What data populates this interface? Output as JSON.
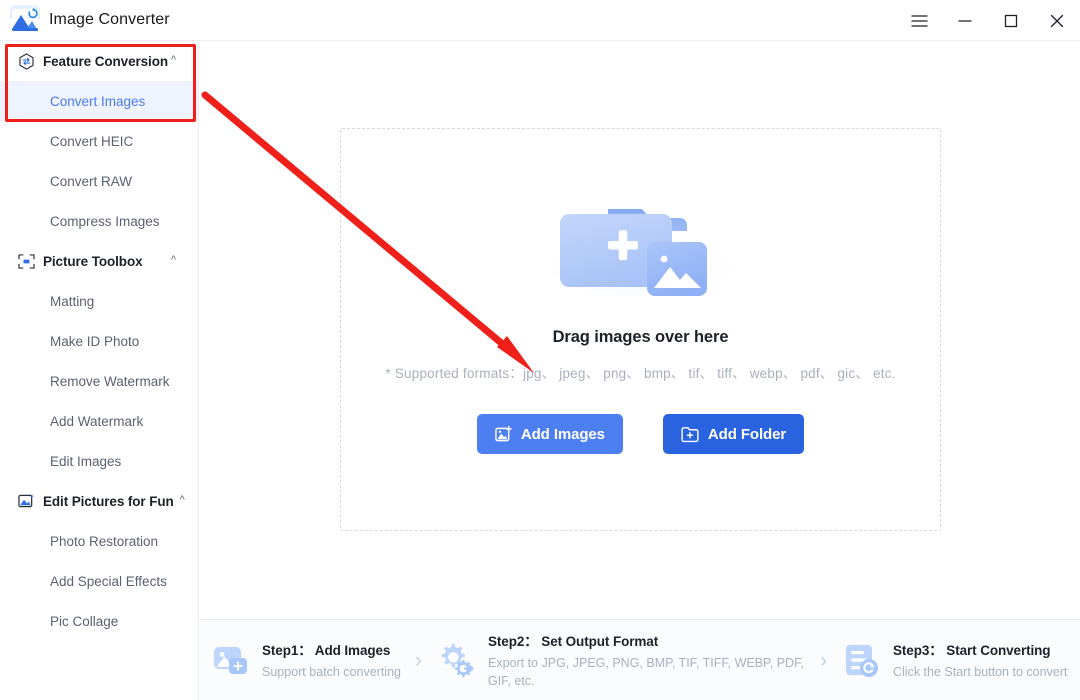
{
  "window": {
    "app_title": "Image Converter",
    "logo_icon": "image-sync-logo",
    "controls": [
      {
        "name": "menu-button",
        "icon": "hamburger-icon"
      },
      {
        "name": "minimize-button",
        "icon": "minimize-icon"
      },
      {
        "name": "maximize-button",
        "icon": "maximize-icon"
      },
      {
        "name": "close-button",
        "icon": "close-icon"
      }
    ]
  },
  "sidebar": {
    "groups": [
      {
        "label": "Feature Conversion",
        "icon": "hexagon-convert-icon",
        "chevron": "chevron-up-icon",
        "expanded": true,
        "items": [
          {
            "label": "Convert Images",
            "active": true
          },
          {
            "label": "Convert HEIC",
            "active": false
          },
          {
            "label": "Convert RAW",
            "active": false
          },
          {
            "label": "Compress Images",
            "active": false
          }
        ]
      },
      {
        "label": "Picture Toolbox",
        "icon": "toolbox-icon",
        "chevron": "chevron-up-icon",
        "expanded": true,
        "items": [
          {
            "label": "Matting",
            "active": false
          },
          {
            "label": "Make ID Photo",
            "active": false
          },
          {
            "label": "Remove Watermark",
            "active": false
          },
          {
            "label": "Add Watermark",
            "active": false
          },
          {
            "label": "Edit Images",
            "active": false
          }
        ]
      },
      {
        "label": "Edit Pictures for Fun",
        "icon": "photo-magic-icon",
        "chevron": "chevron-up-icon",
        "expanded": true,
        "items": [
          {
            "label": "Photo Restoration",
            "active": false
          },
          {
            "label": "Add Special Effects",
            "active": false
          },
          {
            "label": "Pic Collage",
            "active": false
          }
        ]
      }
    ]
  },
  "dropzone": {
    "illustration_icon": "folder-add-image-illustration",
    "title": "Drag images over here",
    "formats_note": "* Supported formats：jpg、 jpeg、 png、 bmp、 tif、 tiff、 webp、 pdf、 gic、 etc.",
    "add_images_button": {
      "label": "Add Images",
      "icon": "image-add-icon"
    },
    "add_folder_button": {
      "label": "Add Folder",
      "icon": "folder-add-icon"
    }
  },
  "steps": {
    "separator_icon": "chevron-right-icon",
    "items": [
      {
        "title": "Step1： Add Images",
        "subtitle": "Support batch converting",
        "icon": "add-images-step-icon"
      },
      {
        "title": "Step2： Set Output Format",
        "subtitle": "Export to JPG, JPEG, PNG, BMP, TIF, TIFF, WEBP, PDF, GIF, etc.",
        "icon": "gear-export-step-icon"
      },
      {
        "title": "Step3： Start Converting",
        "subtitle": "Click the Start button to convert",
        "icon": "convert-document-step-icon"
      }
    ]
  },
  "annotations": {
    "highlight_box": {
      "name": "feature-conversion-highlight",
      "color": "#ef1f19"
    },
    "arrow": {
      "name": "pointer-arrow",
      "color": "#ef1f19"
    }
  },
  "colors": {
    "accent_light": "#4d7ff0",
    "accent_dark": "#2a63e0",
    "active_item_bg": "#eef3fd",
    "annotation_red": "#ef1f19"
  }
}
